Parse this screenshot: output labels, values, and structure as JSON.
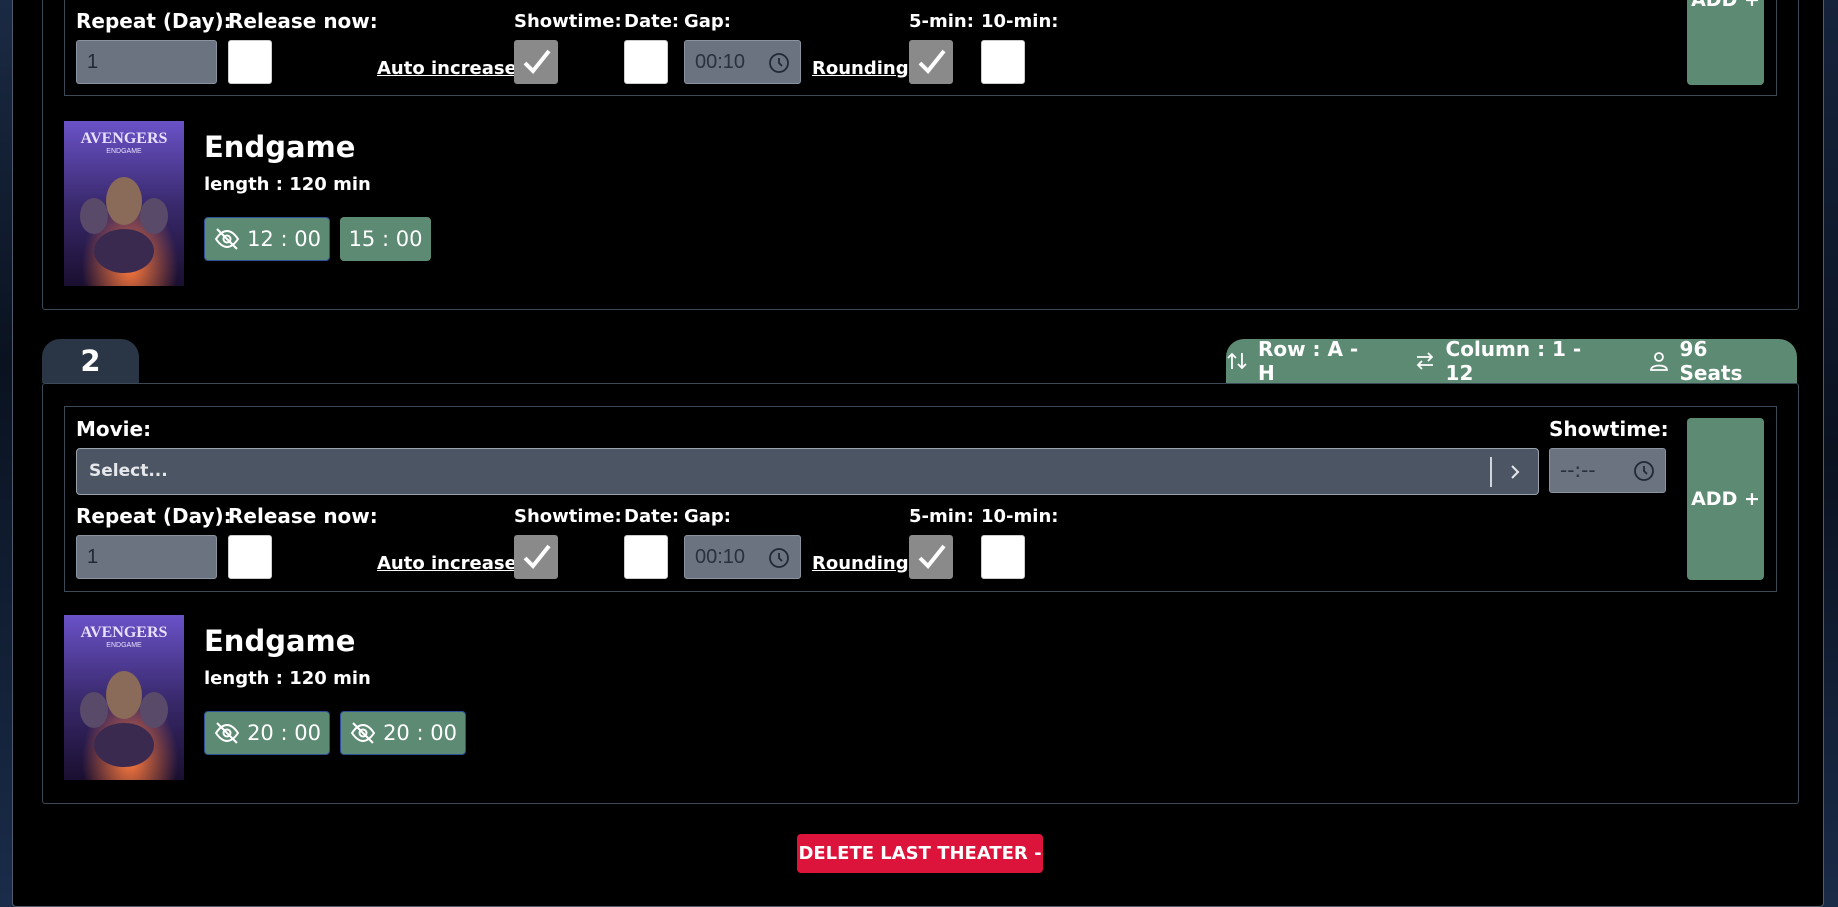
{
  "theater1": {
    "form": {
      "repeat_label": "Repeat (Day):",
      "repeat_value": "1",
      "release_now_label": "Release now:",
      "showtime_label": "Showtime:",
      "auto_increase_label": "Auto increase",
      "date_label": "Date:",
      "gap_label": "Gap:",
      "gap_value": "00:10",
      "rounding_label": "Rounding",
      "five_min_label": "5-min:",
      "ten_min_label": "10-min:",
      "add_label": "ADD +"
    },
    "movie": {
      "title": "Endgame",
      "length": "length : 120 min",
      "showtimes": [
        "12 : 00",
        "15 : 00"
      ]
    }
  },
  "theater2": {
    "number": "2",
    "row_info": "Row : A - H",
    "column_info": "Column : 1 - 12",
    "seats_info": "96 Seats",
    "form": {
      "movie_label": "Movie:",
      "movie_placeholder": "Select...",
      "showtime_top_label": "Showtime:",
      "showtime_value": "--:--",
      "repeat_label": "Repeat (Day):",
      "repeat_value": "1",
      "release_now_label": "Release now:",
      "showtime_label": "Showtime:",
      "auto_increase_label": "Auto increase",
      "date_label": "Date:",
      "gap_label": "Gap:",
      "gap_value": "00:10",
      "rounding_label": "Rounding",
      "five_min_label": "5-min:",
      "ten_min_label": "10-min:",
      "add_label": "ADD +"
    },
    "movie": {
      "title": "Endgame",
      "length": "length : 120 min",
      "showtimes": [
        "20 : 00",
        "20 : 00"
      ]
    }
  },
  "delete_label": "DELETE LAST THEATER -",
  "colors": {
    "accent_green": "#5d8a73",
    "danger_red": "#dc143c",
    "tab_dark": "#2a3646"
  }
}
